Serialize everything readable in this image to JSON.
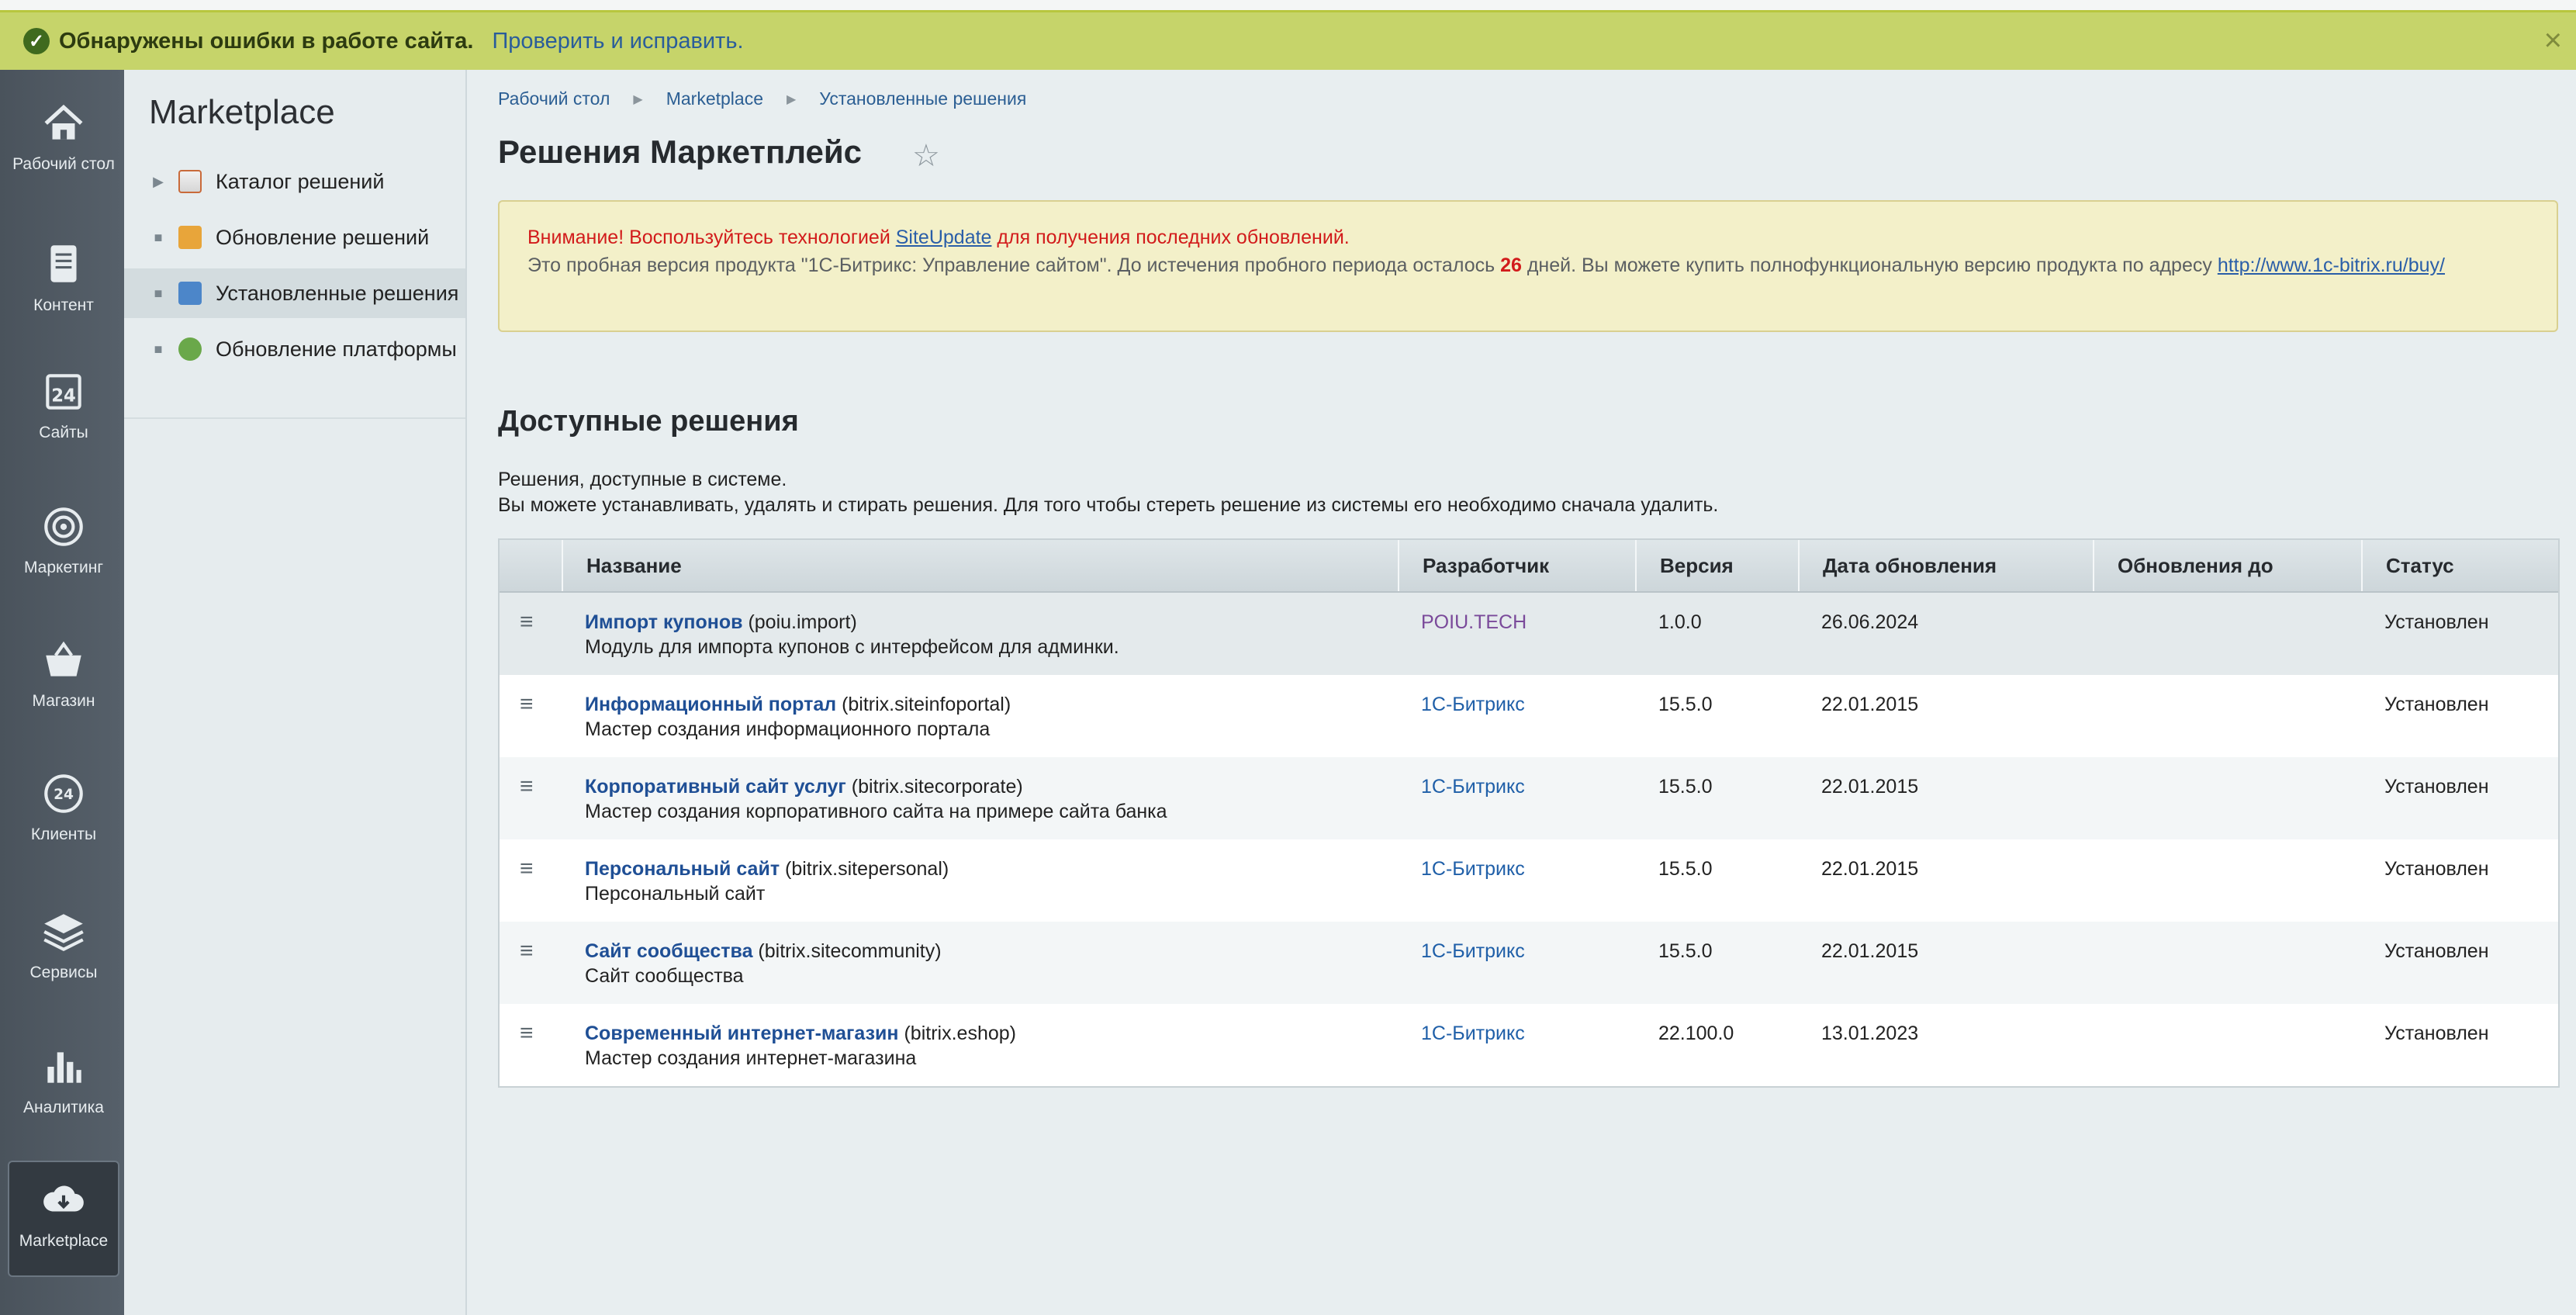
{
  "alert": {
    "message": "Обнаружены ошибки в работе сайта.",
    "link": "Проверить и исправить."
  },
  "leftnav": {
    "items": [
      {
        "label": "Рабочий стол",
        "icon": "home-icon"
      },
      {
        "label": "Контент",
        "icon": "document-icon"
      },
      {
        "label": "Сайты",
        "icon": "calendar-24-icon"
      },
      {
        "label": "Маркетинг",
        "icon": "target-icon"
      },
      {
        "label": "Магазин",
        "icon": "basket-icon"
      },
      {
        "label": "Клиенты",
        "icon": "clients-24-icon"
      },
      {
        "label": "Сервисы",
        "icon": "layers-icon"
      },
      {
        "label": "Аналитика",
        "icon": "bar-chart-icon"
      },
      {
        "label": "Marketplace",
        "icon": "cloud-download-icon",
        "active": true
      }
    ]
  },
  "subnav": {
    "title": "Marketplace",
    "items": [
      {
        "label": "Каталог решений",
        "bullet": "▶"
      },
      {
        "label": "Обновление решений",
        "bullet": "■"
      },
      {
        "label": "Установленные решения",
        "bullet": "■",
        "active": true
      },
      {
        "label": "Обновление платформы",
        "bullet": "■"
      }
    ]
  },
  "breadcrumbs": [
    "Рабочий стол",
    "Marketplace",
    "Установленные решения"
  ],
  "page_title": "Решения Маркетплейс",
  "notice": {
    "line1_prefix": "Внимание! Воспользуйтесь технологией",
    "line1_link": "SiteUpdate",
    "line1_suffix": "для получения последних обновлений.",
    "line2_prefix": "Это пробная версия продукта \"1С-Битрикс: Управление сайтом\". До истечения пробного периода осталось",
    "days": "26",
    "line2_suffix": "дней. Вы можете купить полнофункциональную версию продукта по адресу",
    "url": "http://www.1c-bitrix.ru/buy/"
  },
  "section": {
    "title": "Доступные решения",
    "desc1": "Решения, доступные в системе.",
    "desc2": "Вы можете устанавливать, удалять и стирать решения. Для того чтобы стереть решение из системы его необходимо сначала удалить."
  },
  "table": {
    "columns": [
      "Название",
      "Разработчик",
      "Версия",
      "Дата обновления",
      "Обновления до",
      "Статус"
    ],
    "rows": [
      {
        "name": "Импорт купонов",
        "code": "(poiu.import)",
        "desc": "Модуль для импорта купонов с интерфейсом для админки.",
        "dev": "POIU.TECH",
        "version": "1.0.0",
        "date": "26.06.2024",
        "until": "",
        "status": "Установлен"
      },
      {
        "name": "Информационный портал",
        "code": "(bitrix.siteinfoportal)",
        "desc": "Мастер создания информационного портала",
        "dev": "1С-Битрикс",
        "version": "15.5.0",
        "date": "22.01.2015",
        "until": "",
        "status": "Установлен"
      },
      {
        "name": "Корпоративный сайт услуг",
        "code": "(bitrix.sitecorporate)",
        "desc": "Мастер создания корпоративного сайта на примере сайта банка",
        "dev": "1С-Битрикс",
        "version": "15.5.0",
        "date": "22.01.2015",
        "until": "",
        "status": "Установлен"
      },
      {
        "name": "Персональный сайт",
        "code": "(bitrix.sitepersonal)",
        "desc": "Персональный сайт",
        "dev": "1С-Битрикс",
        "version": "15.5.0",
        "date": "22.01.2015",
        "until": "",
        "status": "Установлен"
      },
      {
        "name": "Сайт сообщества",
        "code": "(bitrix.sitecommunity)",
        "desc": "Сайт сообщества",
        "dev": "1С-Битрикс",
        "version": "15.5.0",
        "date": "22.01.2015",
        "until": "",
        "status": "Установлен"
      },
      {
        "name": "Современный интернет-магазин",
        "code": "(bitrix.eshop)",
        "desc": "Мастер создания интернет-магазина",
        "dev": "1С-Битрикс",
        "version": "22.100.0",
        "date": "13.01.2023",
        "until": "",
        "status": "Установлен"
      }
    ]
  }
}
